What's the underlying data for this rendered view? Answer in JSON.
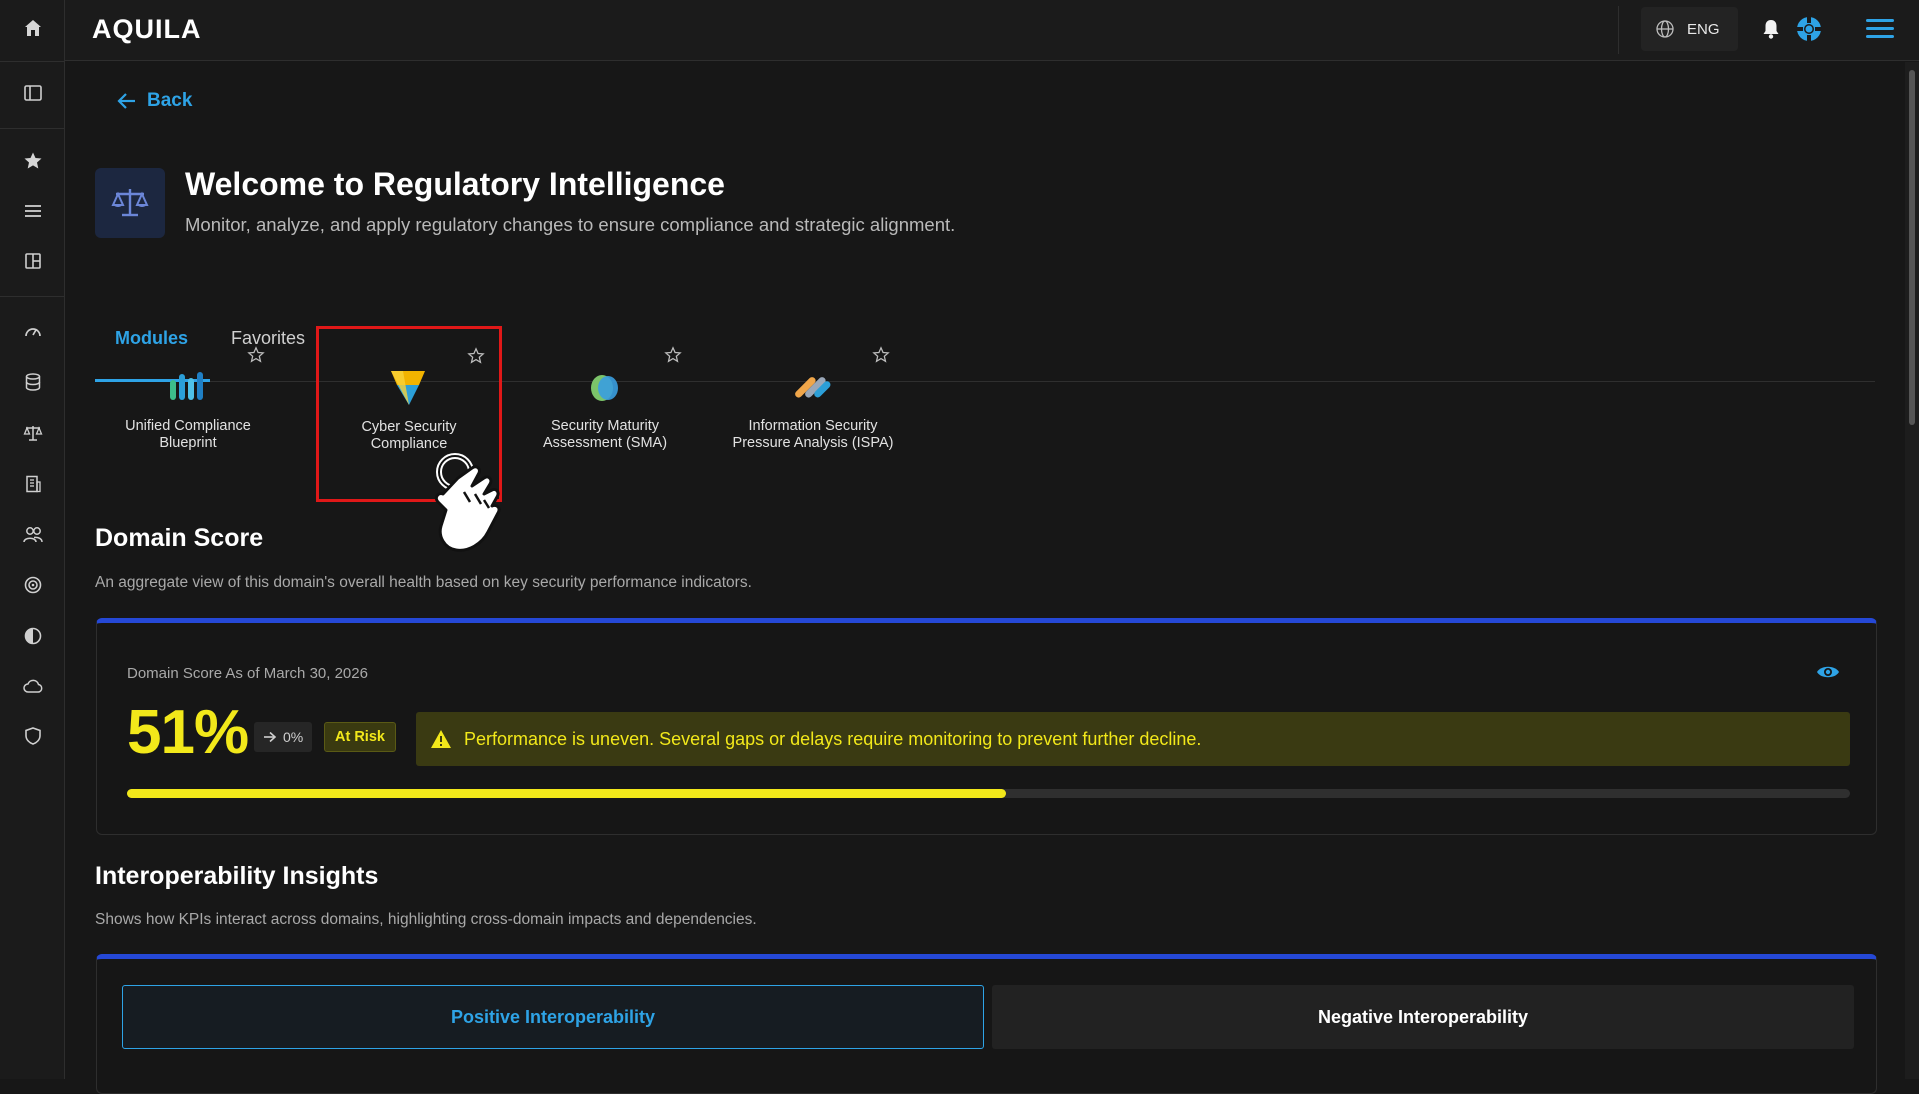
{
  "app": {
    "logo": "AQUILA",
    "language": "ENG"
  },
  "nav": {
    "back_label": "Back"
  },
  "header": {
    "title": "Welcome to Regulatory Intelligence",
    "subtitle": "Monitor, analyze, and apply regulatory changes to ensure compliance and strategic alignment."
  },
  "tabs": [
    {
      "label": "Modules",
      "active": true
    },
    {
      "label": "Favorites",
      "active": false
    }
  ],
  "modules": [
    {
      "label": "Unified Compliance Blueprint",
      "icon": "bars-chart-icon",
      "highlighted": false
    },
    {
      "label": "Cyber Security Compliance",
      "icon": "shield-v-icon",
      "highlighted": true
    },
    {
      "label": "Security Maturity Assessment (SMA)",
      "icon": "leaf-icon",
      "highlighted": false
    },
    {
      "label": "Information Security Pressure Analysis (ISPA)",
      "icon": "slashes-icon",
      "highlighted": false
    }
  ],
  "domain_score": {
    "title": "Domain Score",
    "description": "An aggregate view of this domain's overall health based on key security performance indicators.",
    "as_of": "Domain Score As of March 30, 2026",
    "value": "51%",
    "progress_fraction": 0.51,
    "trend": "0%",
    "status": "At Risk",
    "alert": "Performance is uneven. Several gaps or delays require monitoring to prevent further decline."
  },
  "interop": {
    "title": "Interoperability Insights",
    "description": "Shows how KPIs interact across domains, highlighting cross-domain impacts and dependencies.",
    "tabs": [
      {
        "label": "Positive Interoperability",
        "active": true
      },
      {
        "label": "Negative Interoperability",
        "active": false
      }
    ]
  },
  "colors": {
    "accent": "#2ea3e6",
    "warning": "#f2e81a",
    "card_border": "#2548d6",
    "highlight": "#e01818"
  }
}
